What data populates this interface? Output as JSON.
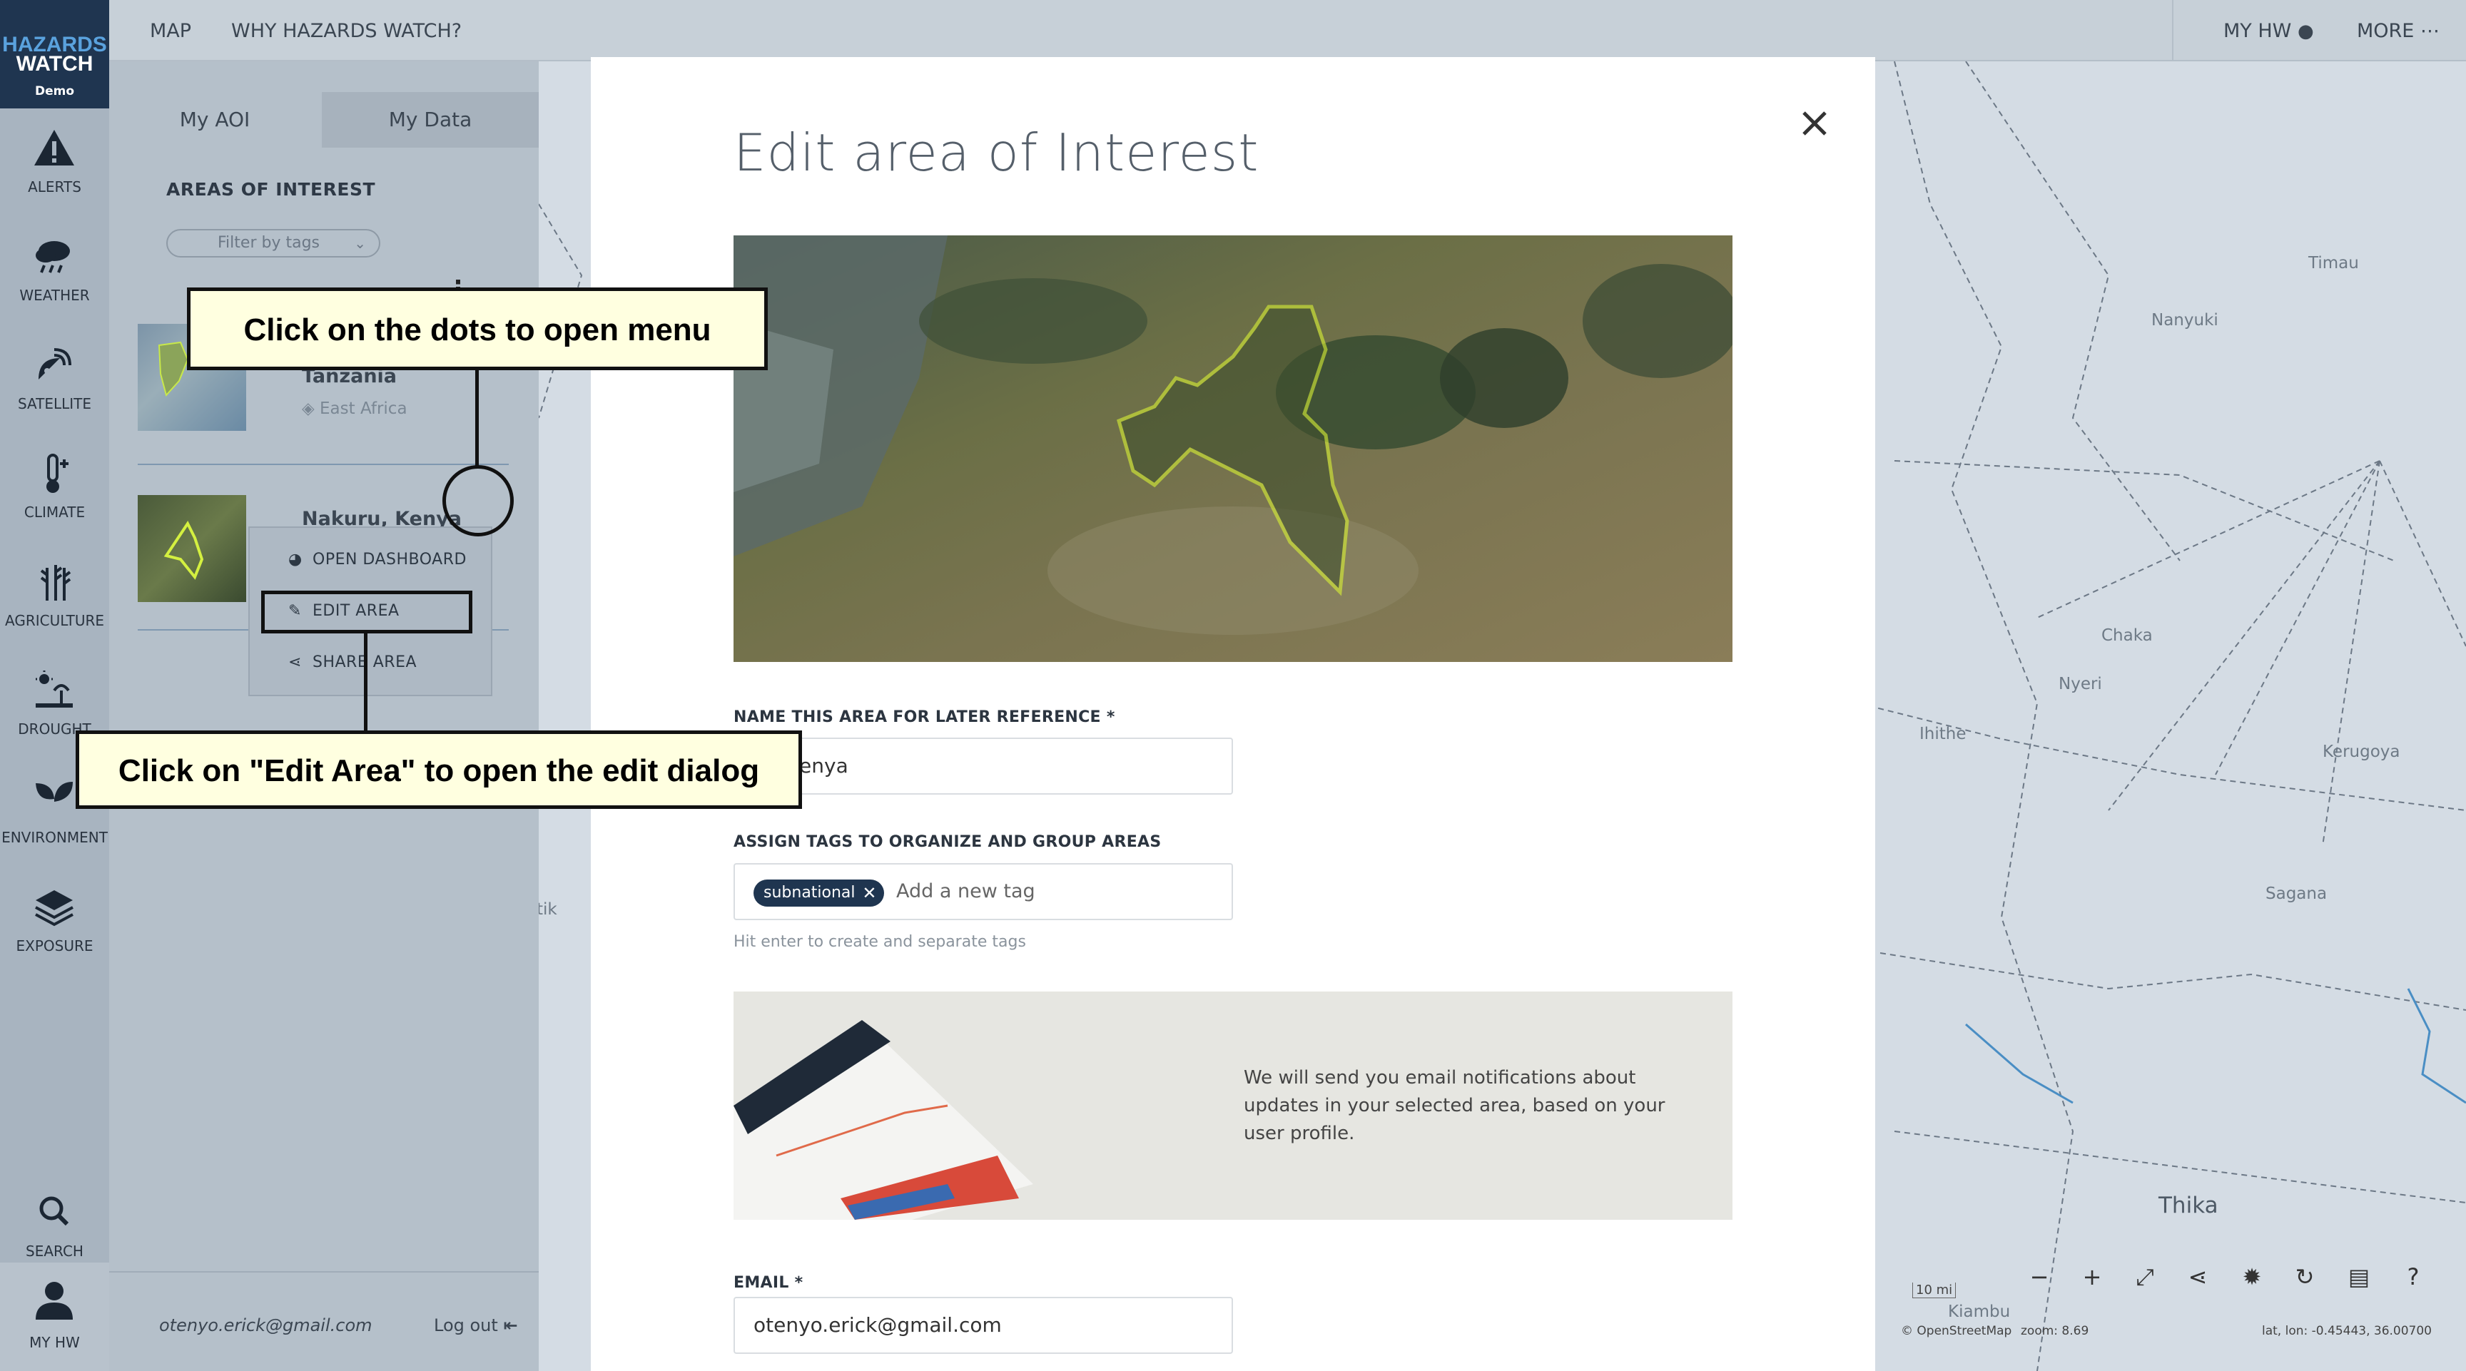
{
  "app": {
    "logo_line1": "HAZARDS",
    "logo_line2": "WATCH",
    "logo_badge": "Demo"
  },
  "topnav": {
    "map": "MAP",
    "why": "WHY HAZARDS WATCH?",
    "my_hw": "MY HW",
    "more": "MORE"
  },
  "rail": {
    "items": [
      {
        "label": "ALERTS",
        "icon": "alert-icon"
      },
      {
        "label": "WEATHER",
        "icon": "cloud-rain-icon"
      },
      {
        "label": "SATELLITE",
        "icon": "satellite-icon"
      },
      {
        "label": "CLIMATE",
        "icon": "thermometer-icon"
      },
      {
        "label": "AGRICULTURE",
        "icon": "wheat-icon"
      },
      {
        "label": "DROUGHT",
        "icon": "drought-icon"
      },
      {
        "label": "ENVIRONMENT",
        "icon": "leaf-icon"
      },
      {
        "label": "EXPOSURE",
        "icon": "layers-icon"
      }
    ],
    "search": "SEARCH",
    "my_hw": "MY HW"
  },
  "panel": {
    "tabs": [
      "My AOI",
      "My Data"
    ],
    "heading": "AREAS OF INTEREST",
    "filter_placeholder": "Filter by tags",
    "areas": [
      {
        "name": "Tanzania",
        "tag": "East Africa"
      },
      {
        "name": "Nakuru, Kenya"
      }
    ],
    "menu": [
      "OPEN DASHBOARD",
      "EDIT AREA",
      "SHARE AREA"
    ],
    "footer_email": "otenyo.erick@gmail.com",
    "logout": "Log out"
  },
  "callouts": {
    "dots": "Click on the dots to open menu",
    "edit": "Click on \"Edit Area\" to open the edit dialog"
  },
  "modal": {
    "title": "Edit area of Interest",
    "name_label": "NAME THIS AREA FOR LATER REFERENCE *",
    "name_value": "ru, Kenya",
    "tags_label": "ASSIGN TAGS TO ORGANIZE AND GROUP AREAS",
    "tag_chip": "subnational",
    "tag_placeholder": "Add a new tag",
    "tags_hint": "Hit enter to create and separate tags",
    "notify_text": "We will send you email notifications about updates in your selected area, based on your user profile.",
    "email_label": "EMAIL *",
    "email_value": "otenyo.erick@gmail.com"
  },
  "map": {
    "places": [
      "Timau",
      "Nanyuki",
      "Chaka",
      "Nyeri",
      "Ihithe",
      "Kerugoya",
      "Sagana",
      "Thika",
      "Kiambu",
      "tik"
    ],
    "scale": "10 mi",
    "attribution": "© OpenStreetMap",
    "zoom": "zoom: 8.69",
    "latlon": "lat, lon: -0.45443, 36.00700"
  }
}
